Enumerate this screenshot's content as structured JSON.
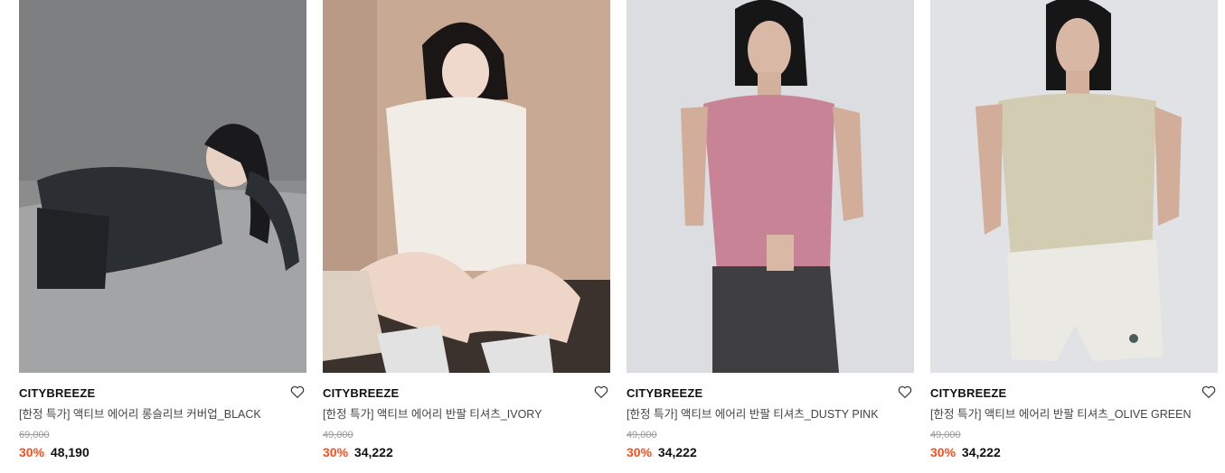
{
  "products": [
    {
      "brand": "CITYBREEZE",
      "name": "[한정 특가] 액티브 에어리 롱슬리브 커버업_BLACK",
      "original_price": "69,000",
      "discount": "30%",
      "price": "48,190",
      "image": "model-lying-black-longsleeve",
      "colors": {
        "bg": "#8d8f90",
        "floor": "#9a9b9c",
        "garment": "#2b2f33"
      }
    },
    {
      "brand": "CITYBREEZE",
      "name": "[한정 특가] 액티브 에어리 반팔 티셔츠_IVORY",
      "original_price": "49,000",
      "discount": "30%",
      "price": "34,222",
      "image": "model-sitting-ivory-tshirt",
      "colors": {
        "bg": "#c9a994",
        "floor": "#3a302c",
        "garment": "#f1ece6"
      }
    },
    {
      "brand": "CITYBREEZE",
      "name": "[한정 특가] 액티브 에어리 반팔 티셔츠_DUSTY PINK",
      "original_price": "49,000",
      "discount": "30%",
      "price": "34,222",
      "image": "model-standing-dustypink-tshirt",
      "colors": {
        "bg": "#dcdde1",
        "floor": "#dcdde1",
        "garment": "#c98397"
      }
    },
    {
      "brand": "CITYBREEZE",
      "name": "[한정 특가] 액티브 에어리 반팔 티셔츠_OLIVE GREEN",
      "original_price": "49,000",
      "discount": "30%",
      "price": "34,222",
      "image": "model-standing-olivegreen-tshirt",
      "colors": {
        "bg": "#e1e2e6",
        "floor": "#e1e2e6",
        "garment": "#d2cdb2"
      }
    }
  ],
  "accent_color": "#ff4d1c",
  "icons": {
    "wishlist": "heart-outline-icon"
  }
}
